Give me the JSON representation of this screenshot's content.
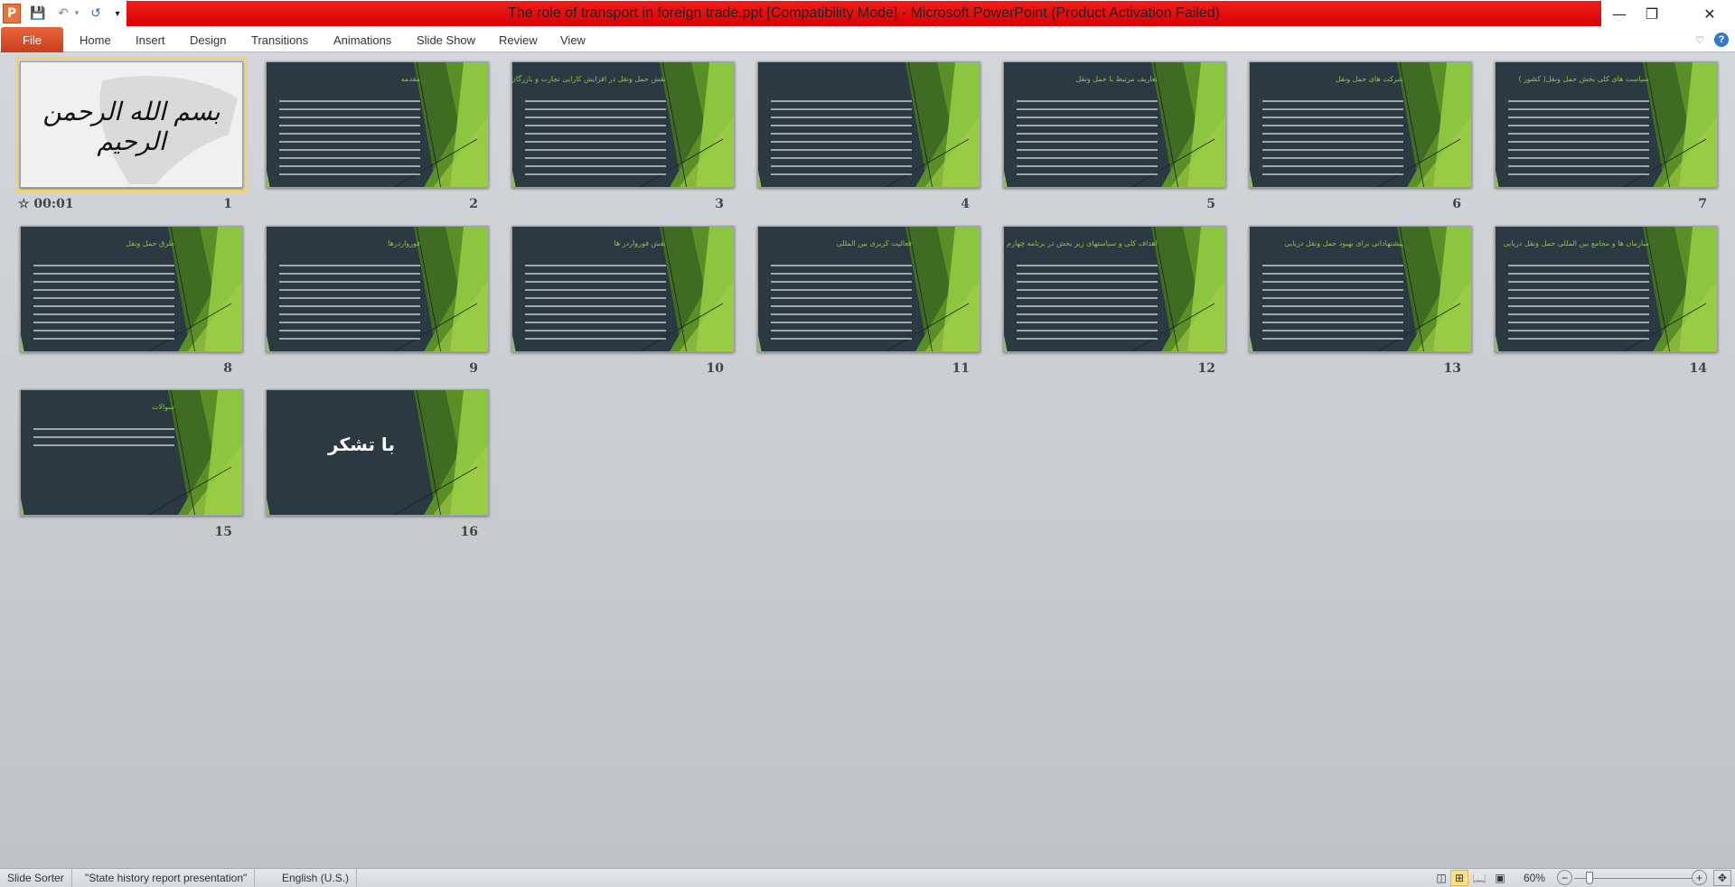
{
  "window": {
    "title": "The role of transport in foreign trade.ppt [Compatibility Mode]  -  Microsoft PowerPoint (Product Activation Failed)",
    "app_icon": "P"
  },
  "ribbon": {
    "file": "File",
    "tabs": [
      "Home",
      "Insert",
      "Design",
      "Transitions",
      "Animations",
      "Slide Show",
      "Review",
      "View"
    ]
  },
  "slides": [
    {
      "number": "1",
      "title": "بسم الله الرحمن الرحیم",
      "timing": "00:01",
      "selected": true
    },
    {
      "number": "2",
      "title": "مقدمه"
    },
    {
      "number": "3",
      "title": "نقش حمل ونقل در افزایش کارایی تجارت و بازرگان"
    },
    {
      "number": "4",
      "title": ""
    },
    {
      "number": "5",
      "title": "تعاریف مرتبط با حمل ونقل"
    },
    {
      "number": "6",
      "title": "شرکت های حمل ونقل"
    },
    {
      "number": "7",
      "title": "سیاست های کلی بخش حمل ونقل( کشور )"
    },
    {
      "number": "8",
      "title": "طرق حمل ونقل"
    },
    {
      "number": "9",
      "title": "فورواردرها"
    },
    {
      "number": "10",
      "title": "نقش فورواردر ها"
    },
    {
      "number": "11",
      "title": "فعالیت کریری بین المللی"
    },
    {
      "number": "12",
      "title": "اهداف کلی و سیاستهای زیر بخش در برنامه چهارم توسعه کشور"
    },
    {
      "number": "13",
      "title": "پیشنهاداتی برای بهبود حمل ونقل دریایی"
    },
    {
      "number": "14",
      "title": "سازمان ها و مجامع بین المللی حمل ونقل دریایی"
    },
    {
      "number": "15",
      "title": "سوالات"
    },
    {
      "number": "16",
      "title": "با تشکر"
    }
  ],
  "status": {
    "view": "Slide Sorter",
    "theme": "\"State history report presentation\"",
    "language": "English (U.S.)",
    "zoom": "60%",
    "zoom_percent": 60
  },
  "colors": {
    "title_bar": "#e00000",
    "file_tab": "#d4512a",
    "slide_bg": "#2b3a42",
    "accent_green": "#8cc63f",
    "selection": "#f3d36a"
  }
}
